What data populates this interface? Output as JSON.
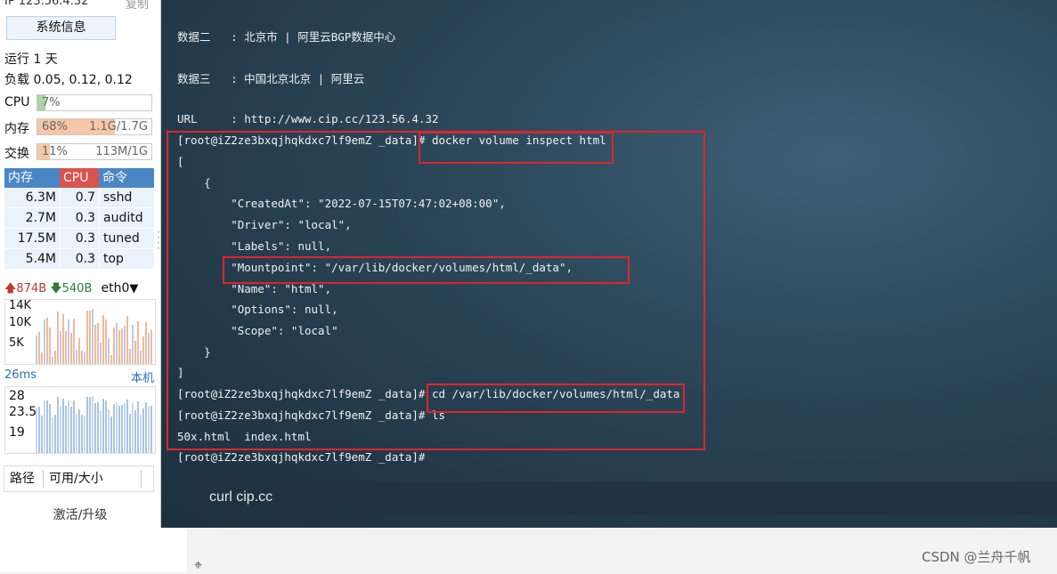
{
  "sidebar": {
    "ip": "IP 123.56.4.32",
    "copy": "复制",
    "sysinfo_button": "系统信息",
    "uptime": "运行 1 天",
    "load": "负载 0.05, 0.12, 0.12",
    "cpu": {
      "label": "CPU",
      "percent": "7%",
      "fill": 7
    },
    "mem": {
      "label": "内存",
      "percent": "68%",
      "amount": "1.1G/1.7G",
      "fill": 68
    },
    "swap": {
      "label": "交换",
      "percent": "11%",
      "amount": "113M/1G",
      "fill": 11
    },
    "proc_table": {
      "headers": [
        "内存",
        "CPU",
        "命令"
      ],
      "rows": [
        {
          "mem": "6.3M",
          "cpu": "0.7",
          "cmd": "sshd"
        },
        {
          "mem": "2.7M",
          "cpu": "0.3",
          "cmd": "auditd"
        },
        {
          "mem": "17.5M",
          "cpu": "0.3",
          "cmd": "tuned"
        },
        {
          "mem": "5.4M",
          "cpu": "0.3",
          "cmd": "top"
        }
      ]
    },
    "net": {
      "up": "874B",
      "down": "540B",
      "iface": "eth0"
    },
    "net_graph": {
      "labels": [
        "14K",
        "10K",
        "5K"
      ]
    },
    "latency": {
      "value": "26ms",
      "target": "本机",
      "labels": [
        "28",
        "23.5",
        "19"
      ]
    },
    "path_header": {
      "path": "路径",
      "usage": "可用/大小"
    },
    "upgrade": "激活/升级"
  },
  "terminal": {
    "lines": [
      "数据二   : 北京市 | 阿里云BGP数据中心",
      "数据三   : 中国北京北京 | 阿里云",
      "URL     : http://www.cip.cc/123.56.4.32",
      "[root@iZ2ze3bxqjhqkdxc7lf9emZ _data]# docker volume inspect html",
      "[",
      "    {",
      "        \"CreatedAt\": \"2022-07-15T07:47:02+08:00\",",
      "        \"Driver\": \"local\",",
      "        \"Labels\": null,",
      "        \"Mountpoint\": \"/var/lib/docker/volumes/html/_data\",",
      "        \"Name\": \"html\",",
      "        \"Options\": null,",
      "        \"Scope\": \"local\"",
      "    }",
      "]",
      "[root@iZ2ze3bxqjhqkdxc7lf9emZ _data]# cd /var/lib/docker/volumes/html/_data",
      "[root@iZ2ze3bxqjhqkdxc7lf9emZ _data]# ls",
      "50x.html  index.html",
      "[root@iZ2ze3bxqjhqkdxc7lf9emZ _data]#"
    ],
    "command_input": "curl cip.cc"
  },
  "watermark": "CSDN @兰舟千帆",
  "colors": {
    "highlight": "#e0242b",
    "cpu_fill": "#a8d5a2",
    "mem_fill": "#f6c7a6",
    "header_mem": "#4a86c5",
    "header_cpu": "#d9534f",
    "header_cmd": "#4a86c5",
    "up_arrow": "#c0392b",
    "down_arrow": "#2e7d32",
    "latency": "#2a6db5"
  }
}
